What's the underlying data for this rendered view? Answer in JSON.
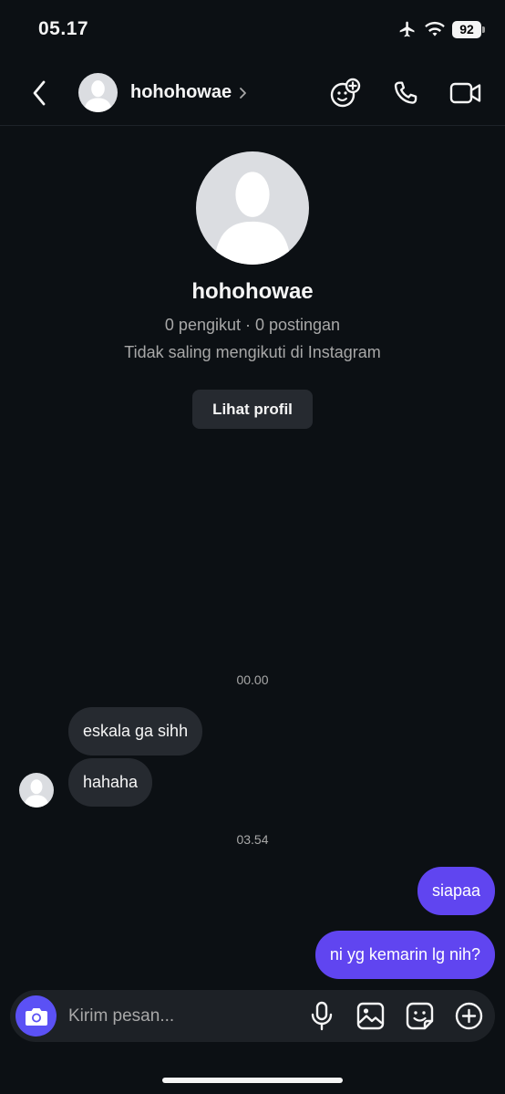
{
  "status_bar": {
    "time": "05.17",
    "battery": "92"
  },
  "header": {
    "username": "hohohowae"
  },
  "profile": {
    "name": "hohohowae",
    "stats": "0 pengikut · 0 postingan",
    "mutual": "Tidak saling mengikuti di Instagram",
    "view_button": "Lihat profil"
  },
  "messages": {
    "timestamp_1": "00.00",
    "incoming": [
      {
        "text": "eskala ga sihh"
      },
      {
        "text": "hahaha"
      }
    ],
    "timestamp_2": "03.54",
    "outgoing": [
      {
        "text": "siapaa"
      },
      {
        "text": "ni yg kemarin lg nih?"
      }
    ]
  },
  "composer": {
    "placeholder": "Kirim pesan..."
  },
  "colors": {
    "background": "#0c1014",
    "incoming_bubble": "#262a30",
    "outgoing_bubble": "#6045f0",
    "camera_button": "#5b51f5"
  },
  "icons": {
    "back": "chevron-left-icon",
    "header_actions": [
      "add-person-icon",
      "phone-icon",
      "video-camera-icon"
    ],
    "composer_actions": [
      "microphone-icon",
      "image-icon",
      "sticker-icon",
      "plus-circle-icon"
    ]
  }
}
